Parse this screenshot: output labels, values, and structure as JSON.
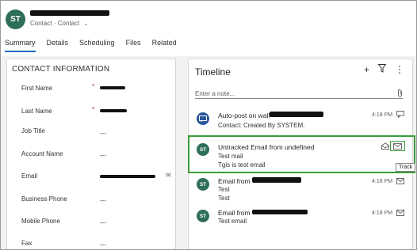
{
  "header": {
    "avatar_initials": "ST",
    "entity_type": "Contact",
    "form_name": "Contact",
    "tabs": [
      "Summary",
      "Details",
      "Scheduling",
      "Files",
      "Related"
    ]
  },
  "contact_info": {
    "section_title": "CONTACT INFORMATION",
    "fields": [
      {
        "label": "First Name",
        "value": "",
        "required": true
      },
      {
        "label": "Last Name",
        "value": "",
        "required": true
      },
      {
        "label": "Job Title",
        "value": "---",
        "required": false
      },
      {
        "label": "Account Name",
        "value": "---",
        "required": false
      },
      {
        "label": "Email",
        "value": "",
        "required": false
      },
      {
        "label": "Business Phone",
        "value": "---",
        "required": false
      },
      {
        "label": "Mobile Phone",
        "value": "---",
        "required": false
      },
      {
        "label": "Fax",
        "value": "---",
        "required": false
      }
    ]
  },
  "timeline": {
    "title": "Timeline",
    "note_placeholder": "Enter a note...",
    "items": [
      {
        "initials": "",
        "title": "Auto-post on wall",
        "subtitle": "Contact: Created By SYSTEM.",
        "subtitle2": "",
        "time": "4:18 PM",
        "icon": "post-icon"
      },
      {
        "initials": "ST",
        "title": "Untracked Email from undefined",
        "subtitle": "Test mail",
        "subtitle2": "Tgis is test email",
        "time": "",
        "icon": "mail-track-icon"
      },
      {
        "initials": "ST",
        "title": "Email from",
        "subtitle": "Test",
        "subtitle2": "Test",
        "time": "4:18 PM",
        "icon": "mail-icon"
      },
      {
        "initials": "ST",
        "title": "Email from",
        "subtitle": "Test",
        "subtitle2": "Test email",
        "time": "4:18 PM",
        "icon": "mail-icon"
      }
    ],
    "track_tooltip": "Track"
  },
  "colors": {
    "avatar": "#2f6e59",
    "highlight": "#3a9b3a",
    "tab_underline": "#0f6cbd"
  }
}
